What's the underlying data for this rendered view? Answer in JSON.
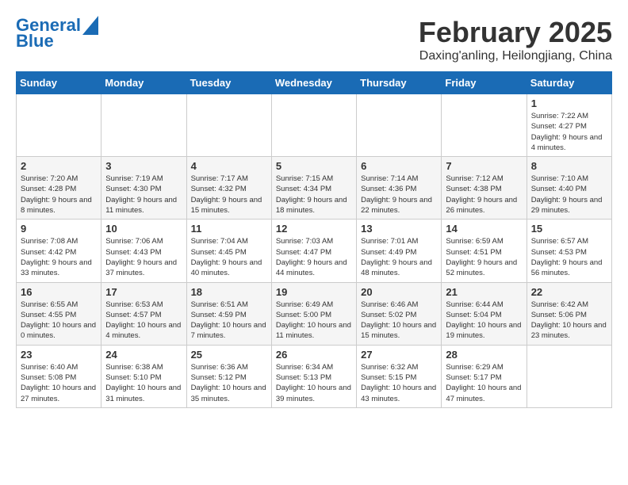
{
  "logo": {
    "line1": "General",
    "line2": "Blue"
  },
  "title": "February 2025",
  "location": "Daxing'anling, Heilongjiang, China",
  "days_of_week": [
    "Sunday",
    "Monday",
    "Tuesday",
    "Wednesday",
    "Thursday",
    "Friday",
    "Saturday"
  ],
  "weeks": [
    [
      {
        "day": "",
        "info": ""
      },
      {
        "day": "",
        "info": ""
      },
      {
        "day": "",
        "info": ""
      },
      {
        "day": "",
        "info": ""
      },
      {
        "day": "",
        "info": ""
      },
      {
        "day": "",
        "info": ""
      },
      {
        "day": "1",
        "info": "Sunrise: 7:22 AM\nSunset: 4:27 PM\nDaylight: 9 hours and 4 minutes."
      }
    ],
    [
      {
        "day": "2",
        "info": "Sunrise: 7:20 AM\nSunset: 4:28 PM\nDaylight: 9 hours and 8 minutes."
      },
      {
        "day": "3",
        "info": "Sunrise: 7:19 AM\nSunset: 4:30 PM\nDaylight: 9 hours and 11 minutes."
      },
      {
        "day": "4",
        "info": "Sunrise: 7:17 AM\nSunset: 4:32 PM\nDaylight: 9 hours and 15 minutes."
      },
      {
        "day": "5",
        "info": "Sunrise: 7:15 AM\nSunset: 4:34 PM\nDaylight: 9 hours and 18 minutes."
      },
      {
        "day": "6",
        "info": "Sunrise: 7:14 AM\nSunset: 4:36 PM\nDaylight: 9 hours and 22 minutes."
      },
      {
        "day": "7",
        "info": "Sunrise: 7:12 AM\nSunset: 4:38 PM\nDaylight: 9 hours and 26 minutes."
      },
      {
        "day": "8",
        "info": "Sunrise: 7:10 AM\nSunset: 4:40 PM\nDaylight: 9 hours and 29 minutes."
      }
    ],
    [
      {
        "day": "9",
        "info": "Sunrise: 7:08 AM\nSunset: 4:42 PM\nDaylight: 9 hours and 33 minutes."
      },
      {
        "day": "10",
        "info": "Sunrise: 7:06 AM\nSunset: 4:43 PM\nDaylight: 9 hours and 37 minutes."
      },
      {
        "day": "11",
        "info": "Sunrise: 7:04 AM\nSunset: 4:45 PM\nDaylight: 9 hours and 40 minutes."
      },
      {
        "day": "12",
        "info": "Sunrise: 7:03 AM\nSunset: 4:47 PM\nDaylight: 9 hours and 44 minutes."
      },
      {
        "day": "13",
        "info": "Sunrise: 7:01 AM\nSunset: 4:49 PM\nDaylight: 9 hours and 48 minutes."
      },
      {
        "day": "14",
        "info": "Sunrise: 6:59 AM\nSunset: 4:51 PM\nDaylight: 9 hours and 52 minutes."
      },
      {
        "day": "15",
        "info": "Sunrise: 6:57 AM\nSunset: 4:53 PM\nDaylight: 9 hours and 56 minutes."
      }
    ],
    [
      {
        "day": "16",
        "info": "Sunrise: 6:55 AM\nSunset: 4:55 PM\nDaylight: 10 hours and 0 minutes."
      },
      {
        "day": "17",
        "info": "Sunrise: 6:53 AM\nSunset: 4:57 PM\nDaylight: 10 hours and 4 minutes."
      },
      {
        "day": "18",
        "info": "Sunrise: 6:51 AM\nSunset: 4:59 PM\nDaylight: 10 hours and 7 minutes."
      },
      {
        "day": "19",
        "info": "Sunrise: 6:49 AM\nSunset: 5:00 PM\nDaylight: 10 hours and 11 minutes."
      },
      {
        "day": "20",
        "info": "Sunrise: 6:46 AM\nSunset: 5:02 PM\nDaylight: 10 hours and 15 minutes."
      },
      {
        "day": "21",
        "info": "Sunrise: 6:44 AM\nSunset: 5:04 PM\nDaylight: 10 hours and 19 minutes."
      },
      {
        "day": "22",
        "info": "Sunrise: 6:42 AM\nSunset: 5:06 PM\nDaylight: 10 hours and 23 minutes."
      }
    ],
    [
      {
        "day": "23",
        "info": "Sunrise: 6:40 AM\nSunset: 5:08 PM\nDaylight: 10 hours and 27 minutes."
      },
      {
        "day": "24",
        "info": "Sunrise: 6:38 AM\nSunset: 5:10 PM\nDaylight: 10 hours and 31 minutes."
      },
      {
        "day": "25",
        "info": "Sunrise: 6:36 AM\nSunset: 5:12 PM\nDaylight: 10 hours and 35 minutes."
      },
      {
        "day": "26",
        "info": "Sunrise: 6:34 AM\nSunset: 5:13 PM\nDaylight: 10 hours and 39 minutes."
      },
      {
        "day": "27",
        "info": "Sunrise: 6:32 AM\nSunset: 5:15 PM\nDaylight: 10 hours and 43 minutes."
      },
      {
        "day": "28",
        "info": "Sunrise: 6:29 AM\nSunset: 5:17 PM\nDaylight: 10 hours and 47 minutes."
      },
      {
        "day": "",
        "info": ""
      }
    ]
  ]
}
